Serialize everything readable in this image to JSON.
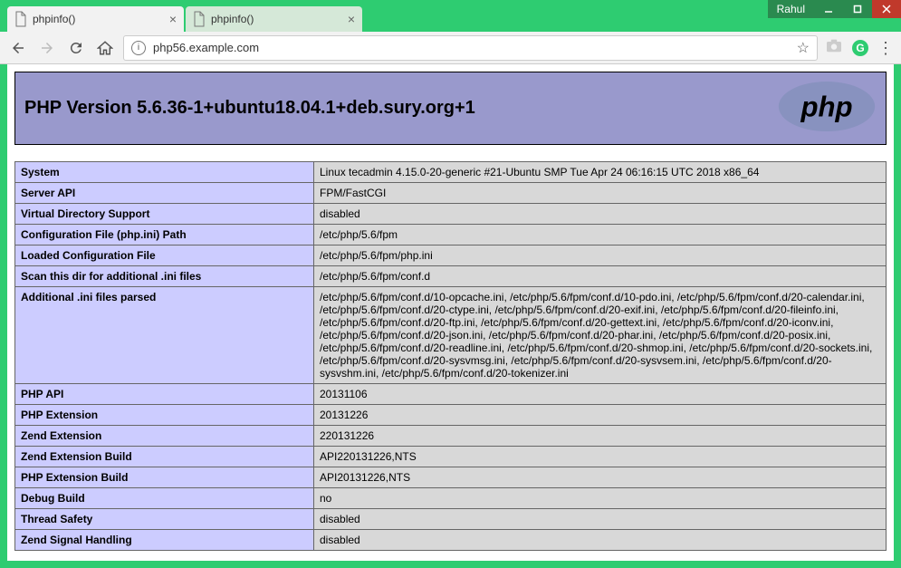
{
  "window": {
    "user_badge": "Rahul"
  },
  "tabs": [
    {
      "title": "phpinfo()",
      "active": true
    },
    {
      "title": "phpinfo()",
      "active": false
    }
  ],
  "omnibox": {
    "url": "php56.example.com"
  },
  "page": {
    "heading": "PHP Version 5.6.36-1+ubuntu18.04.1+deb.sury.org+1",
    "rows": [
      {
        "label": "System",
        "value": "Linux tecadmin 4.15.0-20-generic #21-Ubuntu SMP Tue Apr 24 06:16:15 UTC 2018 x86_64"
      },
      {
        "label": "Server API",
        "value": "FPM/FastCGI"
      },
      {
        "label": "Virtual Directory Support",
        "value": "disabled"
      },
      {
        "label": "Configuration File (php.ini) Path",
        "value": "/etc/php/5.6/fpm"
      },
      {
        "label": "Loaded Configuration File",
        "value": "/etc/php/5.6/fpm/php.ini"
      },
      {
        "label": "Scan this dir for additional .ini files",
        "value": "/etc/php/5.6/fpm/conf.d"
      },
      {
        "label": "Additional .ini files parsed",
        "value": "/etc/php/5.6/fpm/conf.d/10-opcache.ini, /etc/php/5.6/fpm/conf.d/10-pdo.ini, /etc/php/5.6/fpm/conf.d/20-calendar.ini, /etc/php/5.6/fpm/conf.d/20-ctype.ini, /etc/php/5.6/fpm/conf.d/20-exif.ini, /etc/php/5.6/fpm/conf.d/20-fileinfo.ini, /etc/php/5.6/fpm/conf.d/20-ftp.ini, /etc/php/5.6/fpm/conf.d/20-gettext.ini, /etc/php/5.6/fpm/conf.d/20-iconv.ini, /etc/php/5.6/fpm/conf.d/20-json.ini, /etc/php/5.6/fpm/conf.d/20-phar.ini, /etc/php/5.6/fpm/conf.d/20-posix.ini, /etc/php/5.6/fpm/conf.d/20-readline.ini, /etc/php/5.6/fpm/conf.d/20-shmop.ini, /etc/php/5.6/fpm/conf.d/20-sockets.ini, /etc/php/5.6/fpm/conf.d/20-sysvmsg.ini, /etc/php/5.6/fpm/conf.d/20-sysvsem.ini, /etc/php/5.6/fpm/conf.d/20-sysvshm.ini, /etc/php/5.6/fpm/conf.d/20-tokenizer.ini"
      },
      {
        "label": "PHP API",
        "value": "20131106"
      },
      {
        "label": "PHP Extension",
        "value": "20131226"
      },
      {
        "label": "Zend Extension",
        "value": "220131226"
      },
      {
        "label": "Zend Extension Build",
        "value": "API220131226,NTS"
      },
      {
        "label": "PHP Extension Build",
        "value": "API20131226,NTS"
      },
      {
        "label": "Debug Build",
        "value": "no"
      },
      {
        "label": "Thread Safety",
        "value": "disabled"
      },
      {
        "label": "Zend Signal Handling",
        "value": "disabled"
      }
    ]
  }
}
